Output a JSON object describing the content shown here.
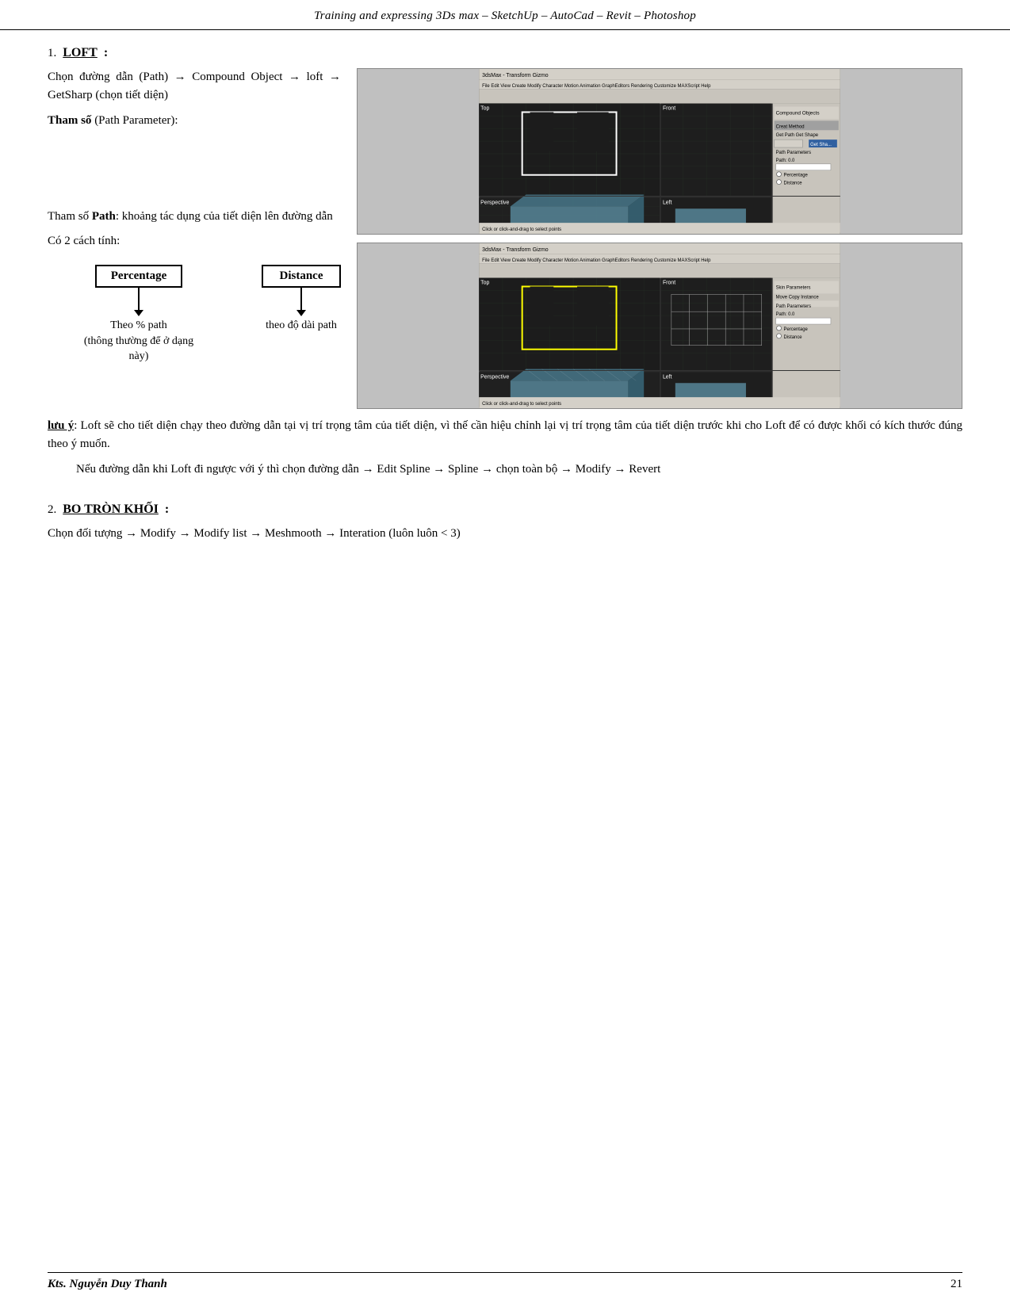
{
  "header": {
    "title": "Training and expressing 3Ds max – SketchUp – AutoCad – Revit – Photoshop"
  },
  "footer": {
    "left": "Kts. Nguyễn Duy Thanh",
    "right": "21"
  },
  "section1": {
    "number": "1.",
    "title": "LOFT",
    "para1": "Chọn đường dẫn (Path) → Compound Object → loft → GetSharp (chọn tiết diện)",
    "para2_bold": "Tham số",
    "para2_rest": " (Path Parameter):",
    "para3": "Tham số ",
    "para3_bold": "Path",
    "para3_rest": ": khoảng tác dụng của tiết diện lên đường dẫn",
    "para4": "Có 2 cách tính:",
    "percentage": "Percentage",
    "distance": "Distance",
    "label_percentage_1": "Theo % path",
    "label_percentage_2": "(thông thường để ở dạng này)",
    "label_distance": "theo độ dài path",
    "note_underline": "lưu ý",
    "note_rest": ": Loft sẽ cho tiết diện chạy theo đường dẫn tại vị trí trọng tâm của tiết diện, vì thế cần hiệu chỉnh lại vị trí trọng tâm của tiết diện trước khi cho Loft để có được khối có kích thước đúng theo ý muốn.",
    "para_indent": "Nếu đường dẫn khi Loft đi ngược với ý thì chọn đường dẫn → Edit Spline → Spline → chọn toàn bộ → Modify → Revert"
  },
  "section2": {
    "number": "2.",
    "title": "BO TRÒN KHỐI",
    "para": "Chọn đối tượng → Modify → Modify list → Meshmooth → Interation (luôn luôn < 3)"
  }
}
